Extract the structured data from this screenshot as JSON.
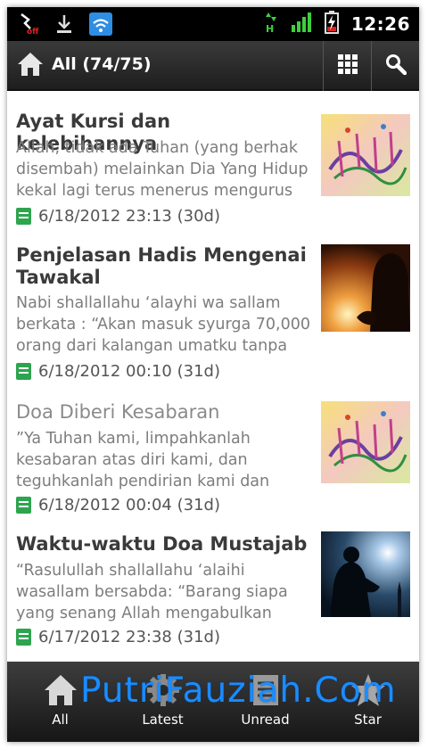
{
  "status_bar": {
    "time": "12:26",
    "icons": [
      "usb-debug-off-icon",
      "download-icon",
      "wifi-icon",
      "data-transfer-icon",
      "signal-icon",
      "battery-charging-icon"
    ]
  },
  "action_bar": {
    "title": "All (74/75)",
    "icons": [
      "home-icon",
      "grid-view-icon",
      "search-icon"
    ]
  },
  "articles": [
    {
      "title": "Ayat Kursi dan kelebihannya",
      "excerpt": [
        "Allah, tidak ada Tuhan (yang berhak",
        "disembah) melainkan Dia Yang Hidup",
        "kekal lagi terus menerus mengurus"
      ],
      "date": "6/18/2012 23:13 (30d)",
      "read": false,
      "thumbnail": "calligraphy-thumbnail"
    },
    {
      "title": "Penjelasan Hadis Mengenai Tawakal",
      "excerpt": [
        "Nabi shallallahu ‘alayhi wa sallam",
        "berkata : “Akan masuk syurga 70,000",
        "orang dari kalangan umatku tanpa"
      ],
      "date": "6/18/2012 00:10 (31d)",
      "read": false,
      "thumbnail": "praying-silhouette-sunset-thumbnail"
    },
    {
      "title": "Doa Diberi Kesabaran",
      "excerpt": [
        "”Ya Tuhan kami, limpahkanlah",
        "kesabaran atas diri kami, dan",
        "teguhkanlah pendirian kami dan"
      ],
      "date": "6/18/2012 00:04 (31d)",
      "read": true,
      "thumbnail": "calligraphy-thumbnail"
    },
    {
      "title": "Waktu-waktu Doa Mustajab",
      "excerpt": [
        "“Rasulullah shallallahu ‘alaihi",
        "wasallam bersabda: “Barang siapa",
        "yang senang Allah mengabulkan"
      ],
      "date": "6/17/2012 23:38 (31d)",
      "read": false,
      "thumbnail": "praying-silhouette-night-thumbnail"
    }
  ],
  "tabs": [
    {
      "label": "All",
      "icon": "home-icon"
    },
    {
      "label": "Latest",
      "icon": "gear-icon"
    },
    {
      "label": "Unread",
      "icon": "document-icon"
    },
    {
      "label": "Star",
      "icon": "star-icon"
    }
  ],
  "watermark": "PutriFauziah.Com",
  "colors": {
    "status_bar": "#000000",
    "action_bar": "#2b2b2b",
    "tab_bar": "#262626",
    "title": "#3a3a3a",
    "title_read": "#8a8a8a",
    "excerpt": "#7d7d7d",
    "doc_icon": "#2ea44f",
    "watermark": "#1a8cff"
  }
}
